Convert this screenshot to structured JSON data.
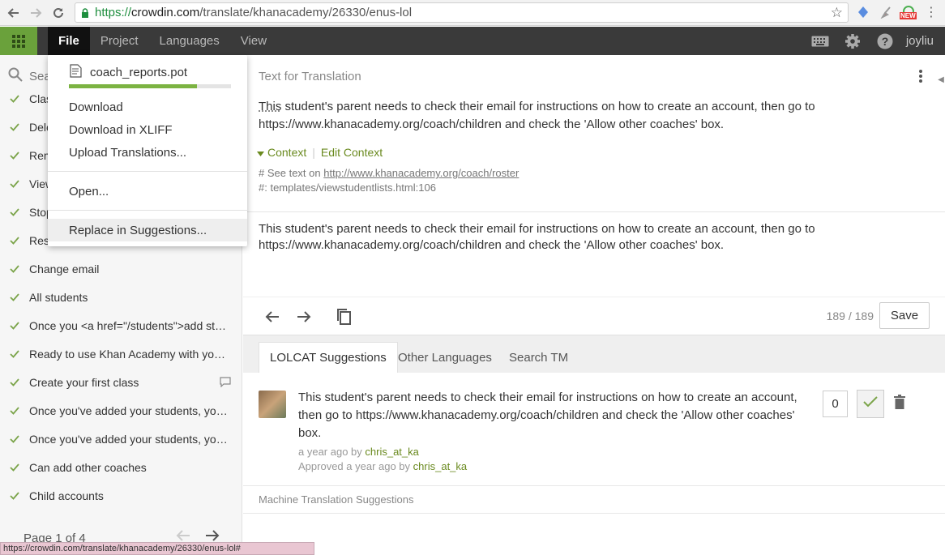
{
  "browser": {
    "url_secure": "https://",
    "url_host": "crowdin.com",
    "url_path": "/translate/khanacademy/26330/enus-lol",
    "ext_new_badge": "NEW"
  },
  "header": {
    "menus": [
      "File",
      "Project",
      "Languages",
      "View"
    ],
    "user": "joyliu"
  },
  "sidebar": {
    "search_placeholder": "Search",
    "items": [
      {
        "label": "Clas"
      },
      {
        "label": "Dele"
      },
      {
        "label": "Rem"
      },
      {
        "label": "View"
      },
      {
        "label": "Stop"
      },
      {
        "label": "Rese"
      },
      {
        "label": "Change email"
      },
      {
        "label": "All students"
      },
      {
        "label": "Once you <a href=\"/students\">add students to your ..."
      },
      {
        "label": "Ready to use Khan Academy with your class?"
      },
      {
        "label": "Create your first class"
      },
      {
        "label": "Once you've added your students, you ..."
      },
      {
        "label": "Once you've added your students, you ..."
      },
      {
        "label": "Can add other coaches"
      },
      {
        "label": "Child accounts"
      }
    ],
    "pager": "Page 1 of 4"
  },
  "dropdown": {
    "file_name": "coach_reports.pot",
    "progress": 0.79,
    "items": [
      "Download",
      "Download in XLIFF",
      "Upload Translations...",
      "Open...",
      "Replace in Suggestions..."
    ]
  },
  "source": {
    "title": "Text for Translation",
    "first_word": "This",
    "text_rest": " student's parent needs to check their email for instructions on how to create an account, then go to https://www.khanacademy.org/coach/children and check the 'Allow other coaches' box.",
    "context_label": "Context",
    "edit_context": "Edit Context",
    "note_prefix": "# See text on ",
    "note_link": "http://www.khanacademy.org/coach/roster",
    "note_line2": "#: templates/viewstudentlists.html:106"
  },
  "translation": {
    "text": "This student's parent needs to check their email for instructions on how to create an account, then go to https://www.khanacademy.org/coach/children and check the 'Allow other coaches' box."
  },
  "toolbar": {
    "counter": "189 / 189",
    "save_label": "Save"
  },
  "tabs": [
    "LOLCAT Suggestions",
    "Other Languages",
    "Search TM"
  ],
  "suggestion": {
    "text": "This student's parent needs to check their email for instructions on how to create an account, then go to https://www.khanacademy.org/coach/children and check the 'Allow other coaches' box.",
    "meta1_prefix": "a year ago by ",
    "meta1_user": "chris_at_ka",
    "meta2_prefix": "Approved a year ago by ",
    "meta2_user": "chris_at_ka",
    "votes": "0"
  },
  "mt_label": "Machine Translation Suggestions",
  "status_bar": "https://crowdin.com/translate/khanacademy/26330/enus-lol#",
  "colors": {
    "accent_green": "#6aa13b",
    "header_bg": "#3a3a3a"
  }
}
